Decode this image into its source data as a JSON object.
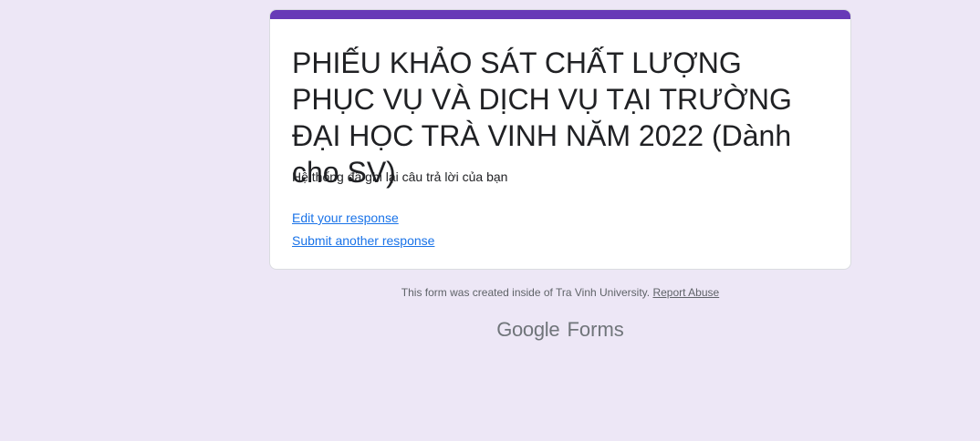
{
  "form": {
    "title": "PHIẾU KHẢO SÁT CHẤT LƯỢNG PHỤC VỤ VÀ DỊCH VỤ TẠI TRƯỜNG ĐẠI HỌC TRÀ VINH NĂM 2022 (Dành cho SV)",
    "confirmation_message": "Hệ thống đã ghi lại câu trả lời của bạn",
    "edit_response_label": "Edit your response",
    "submit_another_label": "Submit another response",
    "accent_color": "#673ab7",
    "background_color": "#ede7f6"
  },
  "footer": {
    "created_text": "This form was created inside of Tra Vinh University.",
    "report_abuse_label": "Report Abuse"
  },
  "brand": {
    "google": "Google",
    "forms": "Forms"
  }
}
